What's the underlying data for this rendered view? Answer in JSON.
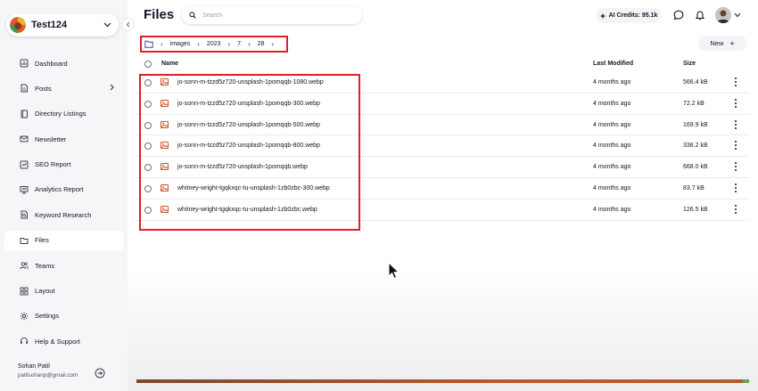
{
  "sidebar": {
    "workspace_name": "Test124",
    "items": [
      {
        "label": "Dashboard",
        "icon": "dashboard-icon"
      },
      {
        "label": "Posts",
        "icon": "document-icon"
      },
      {
        "label": "Directory Listings",
        "icon": "book-icon"
      },
      {
        "label": "Newsletter",
        "icon": "mail-icon"
      },
      {
        "label": "SEO Report",
        "icon": "seo-report-icon"
      },
      {
        "label": "Analytics Report",
        "icon": "presentation-chart-icon"
      },
      {
        "label": "Keyword Research",
        "icon": "search-document-icon"
      },
      {
        "label": "Files",
        "icon": "folder-icon"
      },
      {
        "label": "Teams",
        "icon": "users-icon"
      },
      {
        "label": "Layout",
        "icon": "grid-icon"
      },
      {
        "label": "Settings",
        "icon": "gear-icon"
      },
      {
        "label": "Help & Support",
        "icon": "headset-icon"
      }
    ],
    "active_item": "Files",
    "user": {
      "name": "Sohan Patil",
      "email": "patilsohanp@gmail.com"
    }
  },
  "header": {
    "title": "Files",
    "search_placeholder": "Search",
    "credits_label": "AI Credits: 95.1k"
  },
  "breadcrumb": [
    "images",
    "2023",
    "7",
    "28"
  ],
  "new_button_label": "New",
  "table": {
    "columns": {
      "name": "Name",
      "modified": "Last Modified",
      "size": "Size"
    },
    "rows": [
      {
        "name": "jo-sonn-m-tzzd5z720-unsplash-1pomqqb-1080.webp",
        "modified": "4 months ago",
        "size": "566.4 kB"
      },
      {
        "name": "jo-sonn-m-tzzd5z720-unsplash-1pomqqb-300.webp",
        "modified": "4 months ago",
        "size": "72.2 kB"
      },
      {
        "name": "jo-sonn-m-tzzd5z720-unsplash-1pomqqb-500.webp",
        "modified": "4 months ago",
        "size": "169.9 kB"
      },
      {
        "name": "jo-sonn-m-tzzd5z720-unsplash-1pomqqb-800.webp",
        "modified": "4 months ago",
        "size": "338.2 kB"
      },
      {
        "name": "jo-sonn-m-tzzd5z720-unsplash-1pomqqb.webp",
        "modified": "4 months ago",
        "size": "668.0 kB"
      },
      {
        "name": "whitney-wright-tgqkxqc-tu-unsplash-1zb0zbc-300.webp",
        "modified": "4 months ago",
        "size": "83.7 kB"
      },
      {
        "name": "whitney-wright-tgqkxqc-tu-unsplash-1zb0zbc.webp",
        "modified": "4 months ago",
        "size": "126.5 kB"
      }
    ]
  },
  "colors": {
    "highlight": "#e11d2a",
    "image_icon": "#c8542b",
    "sidebar_bg": "#f6f6f8"
  }
}
